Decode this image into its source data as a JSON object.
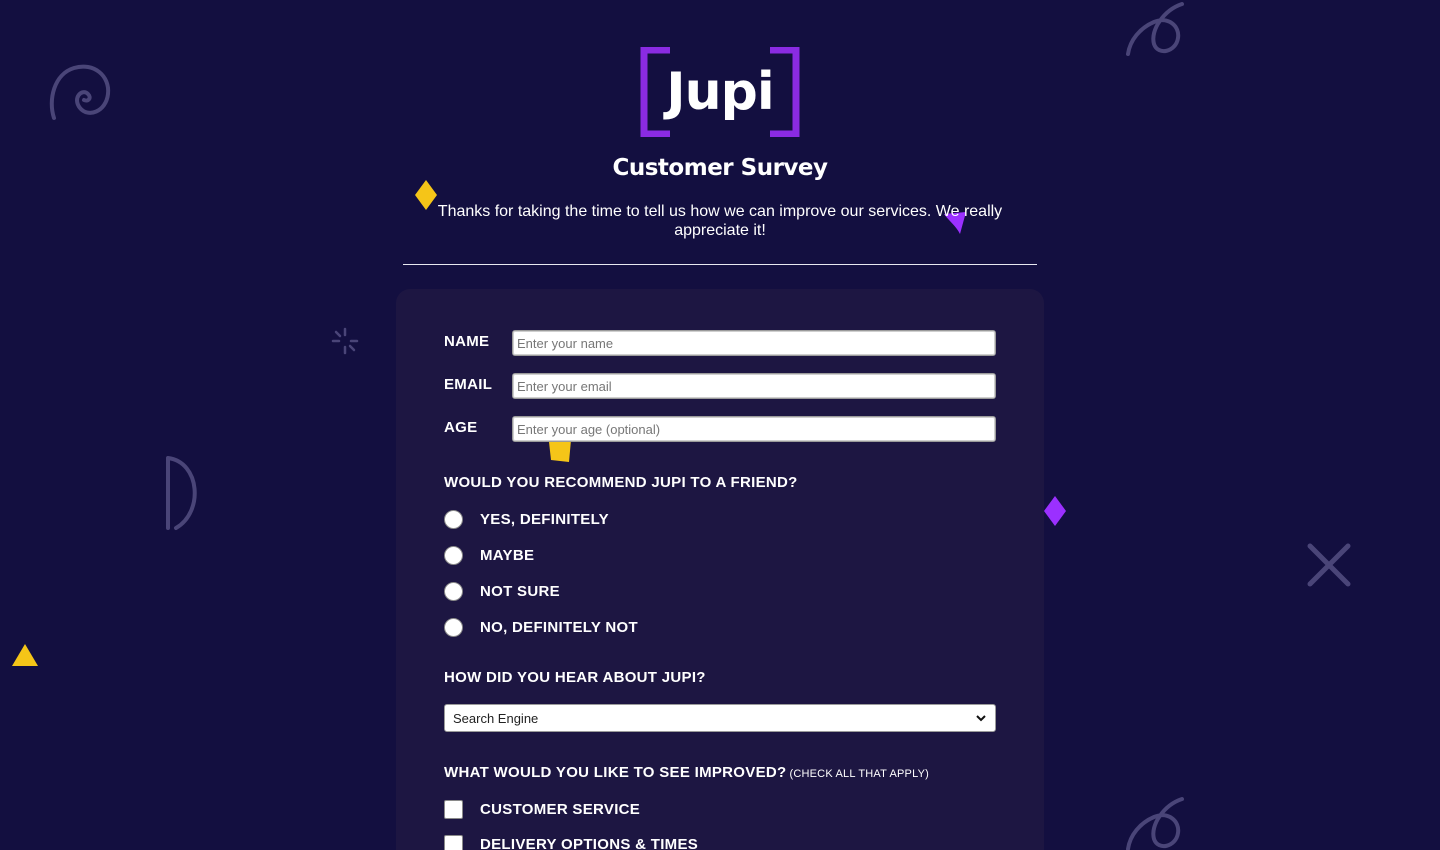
{
  "header": {
    "logo_text": "Jupi",
    "title": "Customer Survey",
    "description": "Thanks for taking the time to tell us how we can improve our services. We really appreciate it!"
  },
  "form": {
    "fields": [
      {
        "label": "NAME",
        "placeholder": "Enter your name"
      },
      {
        "label": "EMAIL",
        "placeholder": "Enter your email"
      },
      {
        "label": "AGE",
        "placeholder": "Enter your age (optional)"
      }
    ],
    "recommend": {
      "question": "WOULD YOU RECOMMEND JUPI TO A FRIEND?",
      "options": [
        "YES, DEFINITELY",
        "MAYBE",
        "NOT SURE",
        "NO, DEFINITELY NOT"
      ]
    },
    "heard": {
      "question": "HOW DID YOU HEAR ABOUT JUPI?",
      "selected": "Search Engine"
    },
    "improve": {
      "question": "WHAT WOULD YOU LIKE TO SEE IMPROVED?",
      "hint": "(CHECK ALL THAT APPLY)",
      "options": [
        "CUSTOMER SERVICE",
        "DELIVERY OPTIONS & TIMES"
      ]
    }
  },
  "colors": {
    "background": "#130f40",
    "card": "#1d1642",
    "brand_purple": "#8a2be2",
    "accent_yellow": "#f5c518",
    "accent_violet": "#9b30ff",
    "doodle": "#4a4578"
  },
  "decorations": [
    "spiral-doodle",
    "curl-doodle",
    "sparkle-doodle",
    "x-doodle",
    "diamond-shape",
    "triangle-shape",
    "square-shape",
    "heart-shape"
  ]
}
